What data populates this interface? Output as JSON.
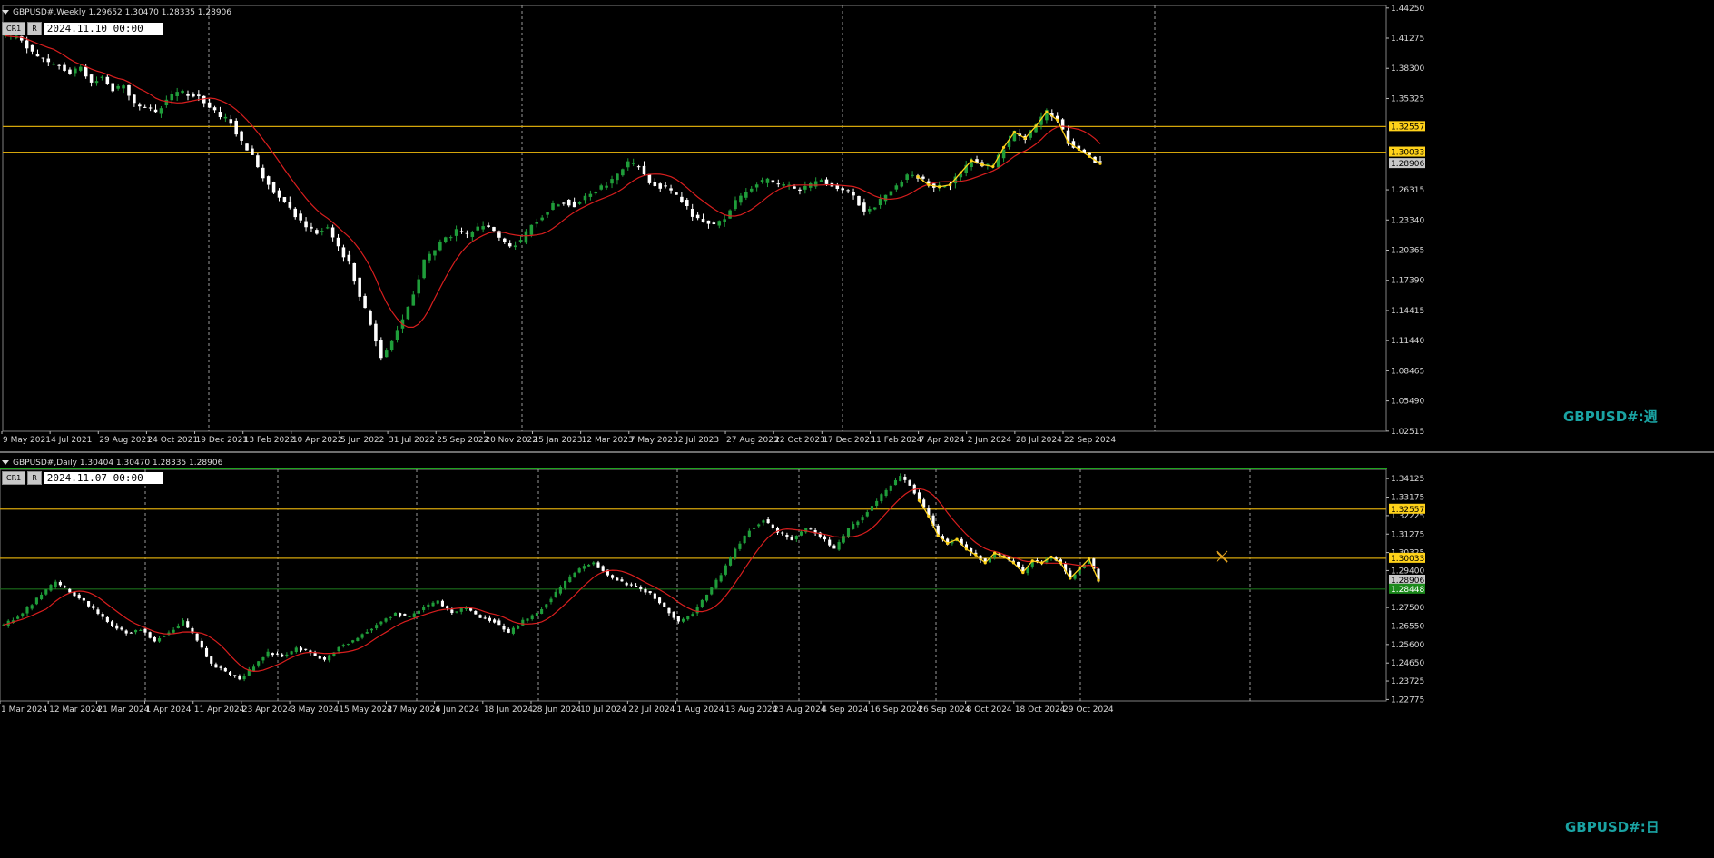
{
  "colors": {
    "background": "#000000",
    "bull_candle": "#1f9d3a",
    "bear_candle": "#ffffff",
    "moving_average": "#d81e1e",
    "zigzag": "#ffd21a",
    "level_line": "#d4a50b",
    "support_line": "#1b6e1b",
    "grid": "#bfbfbf",
    "watermark": "#1aa3a3"
  },
  "weekly": {
    "header": "GBPUSD#,Weekly  1.29652 1.30470 1.28335 1.28906",
    "buttons": [
      "CR1",
      "R"
    ],
    "date_value": "2024.11.10 00:00",
    "watermark": "GBPUSD#:週",
    "price_badges": [
      "1.32557",
      "1.30033",
      "1.28906"
    ]
  },
  "daily": {
    "header": "GBPUSD#,Daily  1.30404 1.30470 1.28335 1.28906",
    "buttons": [
      "CR1",
      "R"
    ],
    "date_value": "2024.11.07 00:00",
    "watermark": "GBPUSD#:日",
    "price_badges": [
      "1.32557",
      "1.30033",
      "1.28906",
      "1.28448"
    ]
  },
  "chart_data": [
    {
      "type": "candlestick",
      "title": "GBPUSD#,Weekly",
      "ohlc_last": {
        "open": 1.29652,
        "high": 1.3047,
        "low": 1.28335,
        "close": 1.28906
      },
      "ylim": [
        1.025,
        1.445
      ],
      "y_ticks": [
        "1.44250",
        "1.41275",
        "1.38300",
        "1.35325",
        "1.32557",
        "1.30033",
        "1.28906",
        "1.26315",
        "1.23340",
        "1.20365",
        "1.17390",
        "1.14415",
        "1.11440",
        "1.08465",
        "1.05490",
        "1.02515"
      ],
      "x_ticks": [
        "9 May 2021",
        "4 Jul 2021",
        "29 Aug 2021",
        "24 Oct 2021",
        "19 Dec 2021",
        "13 Feb 2022",
        "10 Apr 2022",
        "5 Jun 2022",
        "31 Jul 2022",
        "25 Sep 2022",
        "20 Nov 2022",
        "15 Jan 2023",
        "12 Mar 2023",
        "7 May 2023",
        "2 Jul 2023",
        "27 Aug 2023",
        "22 Oct 2023",
        "17 Dec 2023",
        "11 Feb 2024",
        "7 Apr 2024",
        "2 Jun 2024",
        "28 Jul 2024",
        "22 Sep 2024"
      ],
      "horizontal_levels": [
        1.32557,
        1.30033
      ],
      "current_price": 1.28906,
      "close_path": [
        [
          0,
          1.415
        ],
        [
          3,
          1.412
        ],
        [
          5,
          1.398
        ],
        [
          8,
          1.388
        ],
        [
          10,
          1.385
        ],
        [
          12,
          1.378
        ],
        [
          14,
          1.384
        ],
        [
          16,
          1.37
        ],
        [
          18,
          1.374
        ],
        [
          20,
          1.362
        ],
        [
          22,
          1.366
        ],
        [
          24,
          1.348
        ],
        [
          26,
          1.345
        ],
        [
          28,
          1.338
        ],
        [
          30,
          1.352
        ],
        [
          32,
          1.36
        ],
        [
          34,
          1.358
        ],
        [
          36,
          1.355
        ],
        [
          38,
          1.345
        ],
        [
          40,
          1.335
        ],
        [
          42,
          1.33
        ],
        [
          44,
          1.31
        ],
        [
          46,
          1.296
        ],
        [
          48,
          1.276
        ],
        [
          50,
          1.262
        ],
        [
          52,
          1.253
        ],
        [
          54,
          1.238
        ],
        [
          56,
          1.228
        ],
        [
          58,
          1.222
        ],
        [
          60,
          1.226
        ],
        [
          62,
          1.205
        ],
        [
          64,
          1.19
        ],
        [
          66,
          1.16
        ],
        [
          68,
          1.13
        ],
        [
          70,
          1.098
        ],
        [
          72,
          1.115
        ],
        [
          74,
          1.135
        ],
        [
          76,
          1.16
        ],
        [
          78,
          1.193
        ],
        [
          80,
          1.205
        ],
        [
          82,
          1.215
        ],
        [
          84,
          1.222
        ],
        [
          86,
          1.218
        ],
        [
          88,
          1.225
        ],
        [
          90,
          1.228
        ],
        [
          92,
          1.215
        ],
        [
          94,
          1.208
        ],
        [
          96,
          1.212
        ],
        [
          98,
          1.228
        ],
        [
          100,
          1.238
        ],
        [
          102,
          1.248
        ],
        [
          104,
          1.252
        ],
        [
          106,
          1.248
        ],
        [
          108,
          1.255
        ],
        [
          110,
          1.262
        ],
        [
          112,
          1.268
        ],
        [
          114,
          1.278
        ],
        [
          116,
          1.29
        ],
        [
          118,
          1.286
        ],
        [
          120,
          1.272
        ],
        [
          122,
          1.266
        ],
        [
          124,
          1.262
        ],
        [
          126,
          1.252
        ],
        [
          128,
          1.238
        ],
        [
          130,
          1.232
        ],
        [
          132,
          1.228
        ],
        [
          134,
          1.236
        ],
        [
          136,
          1.252
        ],
        [
          138,
          1.262
        ],
        [
          140,
          1.27
        ],
        [
          142,
          1.272
        ],
        [
          144,
          1.268
        ],
        [
          146,
          1.266
        ],
        [
          148,
          1.264
        ],
        [
          150,
          1.268
        ],
        [
          152,
          1.274
        ],
        [
          154,
          1.268
        ],
        [
          156,
          1.262
        ],
        [
          158,
          1.258
        ],
        [
          160,
          1.242
        ],
        [
          162,
          1.248
        ],
        [
          164,
          1.258
        ],
        [
          166,
          1.268
        ],
        [
          168,
          1.278
        ],
        [
          170,
          1.276
        ],
        [
          172,
          1.268
        ],
        [
          174,
          1.266
        ],
        [
          176,
          1.268
        ],
        [
          178,
          1.28
        ],
        [
          180,
          1.292
        ],
        [
          182,
          1.288
        ],
        [
          184,
          1.286
        ],
        [
          186,
          1.305
        ],
        [
          188,
          1.32
        ],
        [
          190,
          1.314
        ],
        [
          192,
          1.326
        ],
        [
          194,
          1.34
        ],
        [
          196,
          1.332
        ],
        [
          198,
          1.31
        ],
        [
          200,
          1.303
        ],
        [
          202,
          1.296
        ],
        [
          204,
          1.289
        ]
      ]
    },
    {
      "type": "candlestick",
      "title": "GBPUSD#,Daily",
      "ohlc_last": {
        "open": 1.30404,
        "high": 1.3047,
        "low": 1.28335,
        "close": 1.28906
      },
      "ylim": [
        1.227,
        1.346
      ],
      "y_ticks": [
        "1.34125",
        "1.33175",
        "1.32557",
        "1.32225",
        "1.31275",
        "1.30325",
        "1.30033",
        "1.29400",
        "1.28906",
        "1.28448",
        "1.27500",
        "1.26550",
        "1.25600",
        "1.24650",
        "1.23725",
        "1.22775"
      ],
      "x_ticks": [
        "1 Mar 2024",
        "12 Mar 2024",
        "21 Mar 2024",
        "1 Apr 2024",
        "11 Apr 2024",
        "23 Apr 2024",
        "3 May 2024",
        "15 May 2024",
        "27 May 2024",
        "6 Jun 2024",
        "18 Jun 2024",
        "28 Jun 2024",
        "10 Jul 2024",
        "22 Jul 2024",
        "1 Aug 2024",
        "13 Aug 2024",
        "23 Aug 2024",
        "4 Sep 2024",
        "16 Sep 2024",
        "26 Sep 2024",
        "8 Oct 2024",
        "18 Oct 2024",
        "29 Oct 2024"
      ],
      "horizontal_levels": [
        1.32557,
        1.30033,
        1.28448
      ],
      "current_price": 1.28906,
      "close_path": [
        [
          0,
          1.266
        ],
        [
          4,
          1.272
        ],
        [
          8,
          1.282
        ],
        [
          11,
          1.288
        ],
        [
          14,
          1.283
        ],
        [
          17,
          1.278
        ],
        [
          20,
          1.272
        ],
        [
          23,
          1.266
        ],
        [
          26,
          1.262
        ],
        [
          29,
          1.264
        ],
        [
          32,
          1.258
        ],
        [
          35,
          1.262
        ],
        [
          38,
          1.268
        ],
        [
          41,
          1.258
        ],
        [
          44,
          1.246
        ],
        [
          47,
          1.242
        ],
        [
          50,
          1.238
        ],
        [
          53,
          1.245
        ],
        [
          56,
          1.252
        ],
        [
          59,
          1.25
        ],
        [
          62,
          1.254
        ],
        [
          65,
          1.252
        ],
        [
          68,
          1.248
        ],
        [
          71,
          1.255
        ],
        [
          74,
          1.258
        ],
        [
          77,
          1.263
        ],
        [
          80,
          1.268
        ],
        [
          83,
          1.272
        ],
        [
          86,
          1.27
        ],
        [
          89,
          1.275
        ],
        [
          92,
          1.278
        ],
        [
          95,
          1.272
        ],
        [
          98,
          1.275
        ],
        [
          101,
          1.27
        ],
        [
          104,
          1.268
        ],
        [
          107,
          1.262
        ],
        [
          110,
          1.268
        ],
        [
          113,
          1.272
        ],
        [
          116,
          1.28
        ],
        [
          119,
          1.288
        ],
        [
          122,
          1.295
        ],
        [
          125,
          1.298
        ],
        [
          128,
          1.292
        ],
        [
          131,
          1.288
        ],
        [
          134,
          1.285
        ],
        [
          137,
          1.282
        ],
        [
          140,
          1.275
        ],
        [
          143,
          1.268
        ],
        [
          146,
          1.272
        ],
        [
          149,
          1.282
        ],
        [
          152,
          1.292
        ],
        [
          155,
          1.305
        ],
        [
          158,
          1.315
        ],
        [
          161,
          1.32
        ],
        [
          164,
          1.314
        ],
        [
          167,
          1.31
        ],
        [
          170,
          1.316
        ],
        [
          173,
          1.312
        ],
        [
          176,
          1.305
        ],
        [
          179,
          1.315
        ],
        [
          182,
          1.322
        ],
        [
          185,
          1.33
        ],
        [
          188,
          1.338
        ],
        [
          190,
          1.342
        ],
        [
          192,
          1.338
        ],
        [
          194,
          1.33
        ],
        [
          196,
          1.322
        ],
        [
          198,
          1.312
        ],
        [
          200,
          1.308
        ],
        [
          202,
          1.31
        ],
        [
          204,
          1.305
        ],
        [
          206,
          1.302
        ],
        [
          208,
          1.298
        ],
        [
          210,
          1.303
        ],
        [
          212,
          1.301
        ],
        [
          214,
          1.298
        ],
        [
          216,
          1.293
        ],
        [
          218,
          1.299
        ],
        [
          220,
          1.298
        ],
        [
          222,
          1.301
        ],
        [
          224,
          1.298
        ],
        [
          226,
          1.29
        ],
        [
          228,
          1.295
        ],
        [
          230,
          1.3
        ],
        [
          232,
          1.289
        ]
      ]
    }
  ]
}
